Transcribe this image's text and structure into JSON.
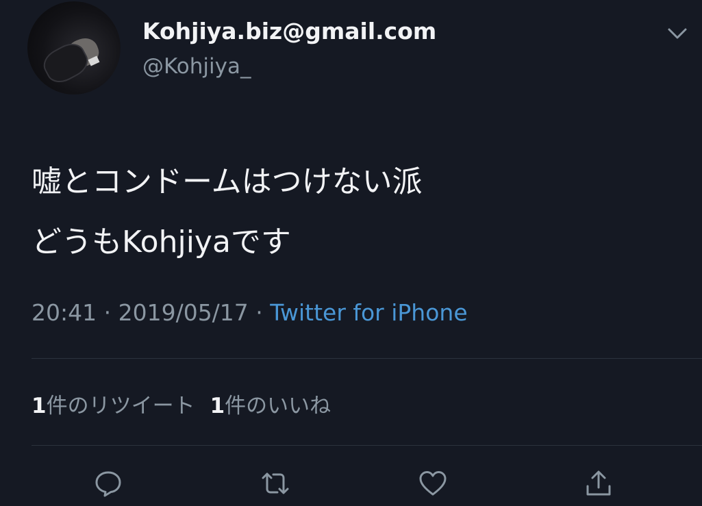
{
  "user": {
    "display_name": "Kohjiya.biz@gmail.com",
    "handle": "@Kohjiya_",
    "avatar_icon": "avatar-photo"
  },
  "tweet": {
    "line1": "嘘とコンドームはつけない派",
    "line2": "どうもKohjiyaです",
    "time": "20:41",
    "separator1": " · ",
    "date": "2019/05/17",
    "separator2": " · ",
    "source": "Twitter for iPhone"
  },
  "stats": {
    "retweet_count": "1",
    "retweet_label": "件のリツイート",
    "like_count": "1",
    "like_label": "件のいいね"
  },
  "actions": [
    {
      "icon": "reply-icon"
    },
    {
      "icon": "retweet-icon"
    },
    {
      "icon": "like-icon"
    },
    {
      "icon": "share-icon"
    }
  ],
  "colors": {
    "background": "#151923",
    "link": "#4a97d6",
    "secondary_text": "#8b97a2",
    "primary_text": "#f2f3f5"
  }
}
